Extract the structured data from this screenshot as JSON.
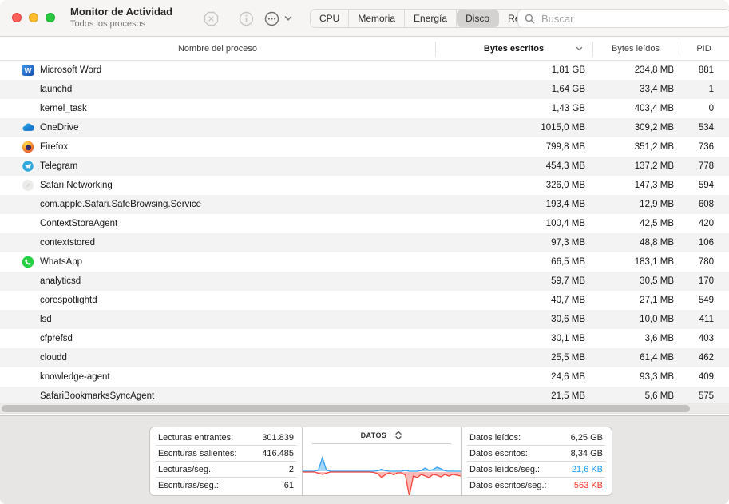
{
  "window": {
    "title": "Monitor de Actividad",
    "subtitle": "Todos los procesos"
  },
  "toolbar": {
    "traffic_lights": [
      "close",
      "minimize",
      "zoom"
    ],
    "icon_buttons": [
      "quit-process-icon",
      "info-icon",
      "more-options-icon"
    ],
    "segments": [
      {
        "label": "CPU",
        "selected": false
      },
      {
        "label": "Memoria",
        "selected": false
      },
      {
        "label": "Energía",
        "selected": false
      },
      {
        "label": "Disco",
        "selected": true
      },
      {
        "label": "Red",
        "selected": false
      }
    ],
    "search_placeholder": "Buscar"
  },
  "table": {
    "columns": [
      {
        "label": "Nombre del proceso",
        "sorted": false
      },
      {
        "label": "Bytes escritos",
        "sorted": true,
        "sort_direction": "desc"
      },
      {
        "label": "Bytes leídos",
        "sorted": false
      },
      {
        "label": "PID",
        "sorted": false
      }
    ],
    "rows": [
      {
        "icon": "word-app",
        "name": "Microsoft Word",
        "bytes_written": "1,81 GB",
        "bytes_read": "234,8 MB",
        "pid": "881"
      },
      {
        "icon": null,
        "name": "launchd",
        "bytes_written": "1,64 GB",
        "bytes_read": "33,4 MB",
        "pid": "1"
      },
      {
        "icon": null,
        "name": "kernel_task",
        "bytes_written": "1,43 GB",
        "bytes_read": "403,4 MB",
        "pid": "0"
      },
      {
        "icon": "onedrive-app",
        "name": "OneDrive",
        "bytes_written": "1015,0 MB",
        "bytes_read": "309,2 MB",
        "pid": "534"
      },
      {
        "icon": "firefox-app",
        "name": "Firefox",
        "bytes_written": "799,8 MB",
        "bytes_read": "351,2 MB",
        "pid": "736"
      },
      {
        "icon": "telegram-app",
        "name": "Telegram",
        "bytes_written": "454,3 MB",
        "bytes_read": "137,2 MB",
        "pid": "778"
      },
      {
        "icon": "safari-networking-app",
        "name": "Safari Networking",
        "bytes_written": "326,0 MB",
        "bytes_read": "147,3 MB",
        "pid": "594"
      },
      {
        "icon": null,
        "name": "com.apple.Safari.SafeBrowsing.Service",
        "bytes_written": "193,4 MB",
        "bytes_read": "12,9 MB",
        "pid": "608"
      },
      {
        "icon": null,
        "name": "ContextStoreAgent",
        "bytes_written": "100,4 MB",
        "bytes_read": "42,5 MB",
        "pid": "420"
      },
      {
        "icon": null,
        "name": "contextstored",
        "bytes_written": "97,3 MB",
        "bytes_read": "48,8 MB",
        "pid": "106"
      },
      {
        "icon": "whatsapp-app",
        "name": "WhatsApp",
        "bytes_written": "66,5 MB",
        "bytes_read": "183,1 MB",
        "pid": "780"
      },
      {
        "icon": null,
        "name": "analyticsd",
        "bytes_written": "59,7 MB",
        "bytes_read": "30,5 MB",
        "pid": "170"
      },
      {
        "icon": null,
        "name": "corespotlightd",
        "bytes_written": "40,7 MB",
        "bytes_read": "27,1 MB",
        "pid": "549"
      },
      {
        "icon": null,
        "name": "lsd",
        "bytes_written": "30,6 MB",
        "bytes_read": "10,0 MB",
        "pid": "411"
      },
      {
        "icon": null,
        "name": "cfprefsd",
        "bytes_written": "30,1 MB",
        "bytes_read": "3,6 MB",
        "pid": "403"
      },
      {
        "icon": null,
        "name": "cloudd",
        "bytes_written": "25,5 MB",
        "bytes_read": "61,4 MB",
        "pid": "462"
      },
      {
        "icon": null,
        "name": "knowledge-agent",
        "bytes_written": "24,6 MB",
        "bytes_read": "93,3 MB",
        "pid": "409"
      },
      {
        "icon": null,
        "name": "SafariBookmarksSyncAgent",
        "bytes_written": "21,5 MB",
        "bytes_read": "5,6 MB",
        "pid": "575"
      }
    ]
  },
  "footer": {
    "left_stats": [
      {
        "label": "Lecturas entrantes:",
        "value": "301.839",
        "color": "default"
      },
      {
        "label": "Escrituras salientes:",
        "value": "416.485",
        "color": "default"
      },
      {
        "label": "Lecturas/seg.:",
        "value": "2",
        "color": "default"
      },
      {
        "label": "Escrituras/seg.:",
        "value": "61",
        "color": "default"
      }
    ],
    "right_stats": [
      {
        "label": "Datos leídos:",
        "value": "6,25 GB",
        "color": "default"
      },
      {
        "label": "Datos escritos:",
        "value": "8,34 GB",
        "color": "default"
      },
      {
        "label": "Datos leídos/seg.:",
        "value": "21,6 KB",
        "color": "blue"
      },
      {
        "label": "Datos escritos/seg.:",
        "value": "563 KB",
        "color": "red"
      }
    ]
  },
  "chart_data": {
    "type": "area",
    "title": "DATOS",
    "x_range": [
      0,
      1
    ],
    "baseline": 0,
    "legend_position": "none",
    "series": [
      {
        "name": "Datos leídos/seg.",
        "direction": "up",
        "stroke": "#2f9ff2",
        "fill": "rgba(100,180,240,0.55)",
        "values": [
          0,
          0,
          0,
          0,
          1.5,
          17,
          1.5,
          0,
          0,
          0,
          0,
          0,
          0,
          0,
          0,
          0,
          0,
          0,
          0,
          0.5,
          2.5,
          0.5,
          0,
          0,
          0,
          0,
          1,
          0,
          0,
          0,
          1,
          4,
          1,
          2,
          5,
          3,
          0.5,
          0,
          0,
          0,
          0
        ]
      },
      {
        "name": "Datos escritos/seg.",
        "direction": "down",
        "stroke": "#f4473e",
        "fill": "rgba(248,120,114,0.5)",
        "values": [
          0,
          0,
          0,
          0,
          1.5,
          3,
          1.5,
          0,
          0,
          0,
          0,
          0,
          0,
          0,
          0,
          0,
          0,
          0,
          0.5,
          2,
          7,
          3,
          1,
          3.5,
          1,
          1,
          4,
          30,
          5,
          7,
          3,
          5,
          7,
          3,
          4,
          6,
          3,
          5,
          3,
          4,
          5
        ]
      }
    ]
  },
  "colors": {
    "accent_blue": "#1d9bf0",
    "accent_red": "#fb352c",
    "row_stripe": "#f4f3f3",
    "selected_segment": "#d4d2d1"
  }
}
